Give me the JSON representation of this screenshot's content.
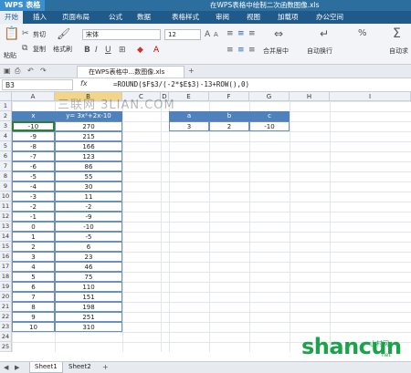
{
  "app": {
    "name": "WPS 表格",
    "window_title": "在WPS表格中绘制二次函数图像.xls"
  },
  "menu": [
    "开始",
    "插入",
    "页面布局",
    "公式",
    "数据",
    "表格样式",
    "审阅",
    "视图",
    "加载项",
    "办公空间"
  ],
  "ribbon": {
    "paste": "粘贴",
    "cut": "剪切",
    "copy": "复制",
    "format_painter": "格式刷",
    "font_name": "宋体",
    "font_size": "12",
    "merge_center": "合并居中",
    "wrap_text": "自动换行",
    "autosum": "自动求"
  },
  "tab": {
    "doc_name": "在WPS表格中...数图像.xls"
  },
  "formula_bar": {
    "cell_ref": "B3",
    "fx": "fx",
    "formula": "=ROUND($F$3/(-2*$E$3)-13+ROW(),0)"
  },
  "columns": [
    "A",
    "B",
    "C",
    "D",
    "E",
    "F",
    "G",
    "H",
    "I"
  ],
  "rows": [
    "1",
    "2",
    "3",
    "4",
    "5",
    "6",
    "7",
    "8",
    "9",
    "10",
    "11",
    "12",
    "13",
    "14",
    "15",
    "16",
    "17",
    "18",
    "19",
    "20",
    "21",
    "22",
    "23",
    "24",
    "25"
  ],
  "table": {
    "header_x": "x",
    "header_y": "y= 3x²+2x-10",
    "x": [
      "-10",
      "-9",
      "-8",
      "-7",
      "-6",
      "-5",
      "-4",
      "-3",
      "-2",
      "-1",
      "0",
      "1",
      "2",
      "3",
      "4",
      "5",
      "6",
      "7",
      "8",
      "9",
      "10"
    ],
    "y": [
      "270",
      "215",
      "166",
      "123",
      "86",
      "55",
      "30",
      "11",
      "-2",
      "-9",
      "-10",
      "-5",
      "6",
      "23",
      "46",
      "75",
      "110",
      "151",
      "198",
      "251",
      "310"
    ]
  },
  "params": {
    "headers": [
      "a",
      "b",
      "c"
    ],
    "values": [
      "3",
      "2",
      "-10"
    ]
  },
  "sheets": [
    "Sheet1",
    "Sheet2"
  ],
  "watermark": "三联网 3LIAN.COM",
  "logo": {
    "text": "shancun",
    "sub": "山村网",
    "url": "net"
  },
  "colors": {
    "header_blue": "#4f81bd",
    "titlebar": "#2c6e9e"
  }
}
